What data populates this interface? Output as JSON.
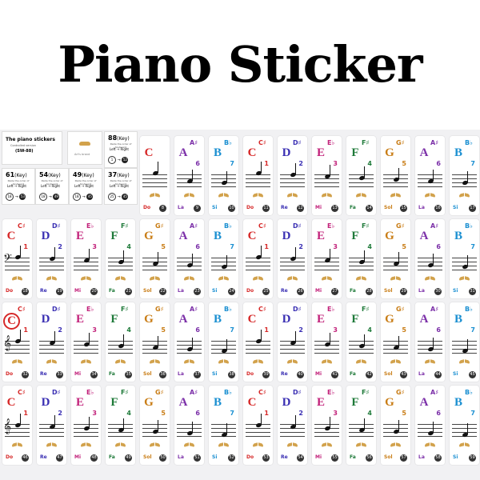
{
  "title": "Piano Sticker",
  "info": {
    "heading": "The piano stickers",
    "sub": "Controlled version",
    "code": "(SW-88)",
    "brand": "Art's brand",
    "instr": "Paste the order of Keyboard",
    "lr_left": "Left",
    "lr_right": "Right",
    "keys": [
      {
        "n": "88",
        "unit": "(Key)",
        "a": "1",
        "b": "52"
      },
      {
        "n": "61",
        "unit": "(Key)",
        "a": "18",
        "b": "53"
      },
      {
        "n": "54",
        "unit": "(Key)",
        "a": "18",
        "b": "49"
      },
      {
        "n": "49",
        "unit": "(Key)",
        "a": "18",
        "b": "45"
      },
      {
        "n": "37",
        "unit": "(Key)",
        "a": "25",
        "b": "45"
      }
    ]
  },
  "colors": {
    "C": "#d62828",
    "D": "#3a2fb3",
    "E": "#c2217a",
    "F": "#1f7a3a",
    "G": "#c97d16",
    "A": "#7b2fa8",
    "B": "#1a8fd1"
  },
  "rows": [
    {
      "start": 4,
      "cells": [
        {
          "l": "C",
          "s": "",
          "n": "",
          "so": "Do",
          "i": "8"
        },
        {
          "l": "A",
          "s": "A♯",
          "n": "6",
          "so": "La",
          "i": "9"
        },
        {
          "l": "B",
          "s": "B♭",
          "n": "7",
          "so": "Si",
          "i": "10"
        },
        {
          "l": "C",
          "s": "C♯",
          "n": "1",
          "so": "Do",
          "i": "11"
        },
        {
          "l": "D",
          "s": "D♯",
          "n": "2",
          "so": "Re",
          "i": "12"
        },
        {
          "l": "E",
          "s": "E♭",
          "n": "3",
          "so": "Mi",
          "i": "13"
        },
        {
          "l": "F",
          "s": "F♯",
          "n": "4",
          "so": "Fa",
          "i": "14"
        },
        {
          "l": "G",
          "s": "G♯",
          "n": "5",
          "so": "Sol",
          "i": "15"
        },
        {
          "l": "A",
          "s": "A♯",
          "n": "6",
          "so": "La",
          "i": "16"
        },
        {
          "l": "B",
          "s": "B♭",
          "n": "7",
          "so": "Si",
          "i": "17"
        }
      ]
    },
    {
      "start": 0,
      "cells": [
        {
          "l": "C",
          "s": "C♯",
          "n": "1",
          "so": "Do",
          "i": "18"
        },
        {
          "l": "D",
          "s": "D♯",
          "n": "2",
          "so": "Re",
          "i": "19"
        },
        {
          "l": "E",
          "s": "E♭",
          "n": "3",
          "so": "Mi",
          "i": "20"
        },
        {
          "l": "F",
          "s": "F♯",
          "n": "4",
          "so": "Fa",
          "i": "21"
        },
        {
          "l": "G",
          "s": "G♯",
          "n": "5",
          "so": "Sol",
          "i": "22"
        },
        {
          "l": "A",
          "s": "A♯",
          "n": "6",
          "so": "La",
          "i": "23"
        },
        {
          "l": "B",
          "s": "B♭",
          "n": "7",
          "so": "Si",
          "i": "24"
        },
        {
          "l": "C",
          "s": "C♯",
          "n": "1",
          "so": "Do",
          "i": "25"
        },
        {
          "l": "D",
          "s": "D♯",
          "n": "2",
          "so": "Re",
          "i": "26"
        },
        {
          "l": "E",
          "s": "E♭",
          "n": "3",
          "so": "Mi",
          "i": "27"
        },
        {
          "l": "F",
          "s": "F♯",
          "n": "4",
          "so": "Fa",
          "i": "28"
        },
        {
          "l": "G",
          "s": "G♯",
          "n": "5",
          "so": "Sol",
          "i": "29"
        },
        {
          "l": "A",
          "s": "A♯",
          "n": "6",
          "so": "La",
          "i": "30"
        },
        {
          "l": "B",
          "s": "B♭",
          "n": "7",
          "so": "Si",
          "i": "31"
        }
      ]
    },
    {
      "start": 0,
      "cells": [
        {
          "l": "C",
          "s": "C♯",
          "n": "1",
          "so": "Do",
          "i": "32",
          "circ": true
        },
        {
          "l": "D",
          "s": "D♯",
          "n": "2",
          "so": "Re",
          "i": "33"
        },
        {
          "l": "E",
          "s": "E♭",
          "n": "3",
          "so": "Mi",
          "i": "34"
        },
        {
          "l": "F",
          "s": "F♯",
          "n": "4",
          "so": "Fa",
          "i": "35"
        },
        {
          "l": "G",
          "s": "G♯",
          "n": "5",
          "so": "Sol",
          "i": "36"
        },
        {
          "l": "A",
          "s": "A♯",
          "n": "6",
          "so": "La",
          "i": "37"
        },
        {
          "l": "B",
          "s": "B♭",
          "n": "7",
          "so": "Si",
          "i": "38"
        },
        {
          "l": "C",
          "s": "C♯",
          "n": "1",
          "so": "Do",
          "i": "39"
        },
        {
          "l": "D",
          "s": "D♯",
          "n": "2",
          "so": "Re",
          "i": "40"
        },
        {
          "l": "E",
          "s": "E♭",
          "n": "3",
          "so": "Mi",
          "i": "41"
        },
        {
          "l": "F",
          "s": "F♯",
          "n": "4",
          "so": "Fa",
          "i": "42"
        },
        {
          "l": "G",
          "s": "G♯",
          "n": "5",
          "so": "Sol",
          "i": "43"
        },
        {
          "l": "A",
          "s": "A♯",
          "n": "6",
          "so": "La",
          "i": "44"
        },
        {
          "l": "B",
          "s": "B♭",
          "n": "7",
          "so": "Si",
          "i": "45"
        }
      ]
    },
    {
      "start": 0,
      "cells": [
        {
          "l": "C",
          "s": "C♯",
          "n": "1",
          "so": "Do",
          "i": "46"
        },
        {
          "l": "D",
          "s": "D♯",
          "n": "2",
          "so": "Re",
          "i": "47"
        },
        {
          "l": "E",
          "s": "E♭",
          "n": "3",
          "so": "Mi",
          "i": "48"
        },
        {
          "l": "F",
          "s": "F♯",
          "n": "4",
          "so": "Fa",
          "i": "49"
        },
        {
          "l": "G",
          "s": "G♯",
          "n": "5",
          "so": "Sol",
          "i": "50"
        },
        {
          "l": "A",
          "s": "A♯",
          "n": "6",
          "so": "La",
          "i": "51"
        },
        {
          "l": "B",
          "s": "B♭",
          "n": "7",
          "so": "Si",
          "i": "52"
        },
        {
          "l": "C",
          "s": "C♯",
          "n": "1",
          "so": "Do",
          "i": "53"
        },
        {
          "l": "D",
          "s": "D♯",
          "n": "2",
          "so": "Re",
          "i": "54"
        },
        {
          "l": "E",
          "s": "E♭",
          "n": "3",
          "so": "Mi",
          "i": "55"
        },
        {
          "l": "F",
          "s": "F♯",
          "n": "4",
          "so": "Fa",
          "i": "56"
        },
        {
          "l": "G",
          "s": "G♯",
          "n": "5",
          "so": "Sol",
          "i": "57"
        },
        {
          "l": "A",
          "s": "A♯",
          "n": "6",
          "so": "La",
          "i": "58"
        },
        {
          "l": "B",
          "s": "B♭",
          "n": "7",
          "so": "Si",
          "i": "59"
        }
      ]
    }
  ]
}
